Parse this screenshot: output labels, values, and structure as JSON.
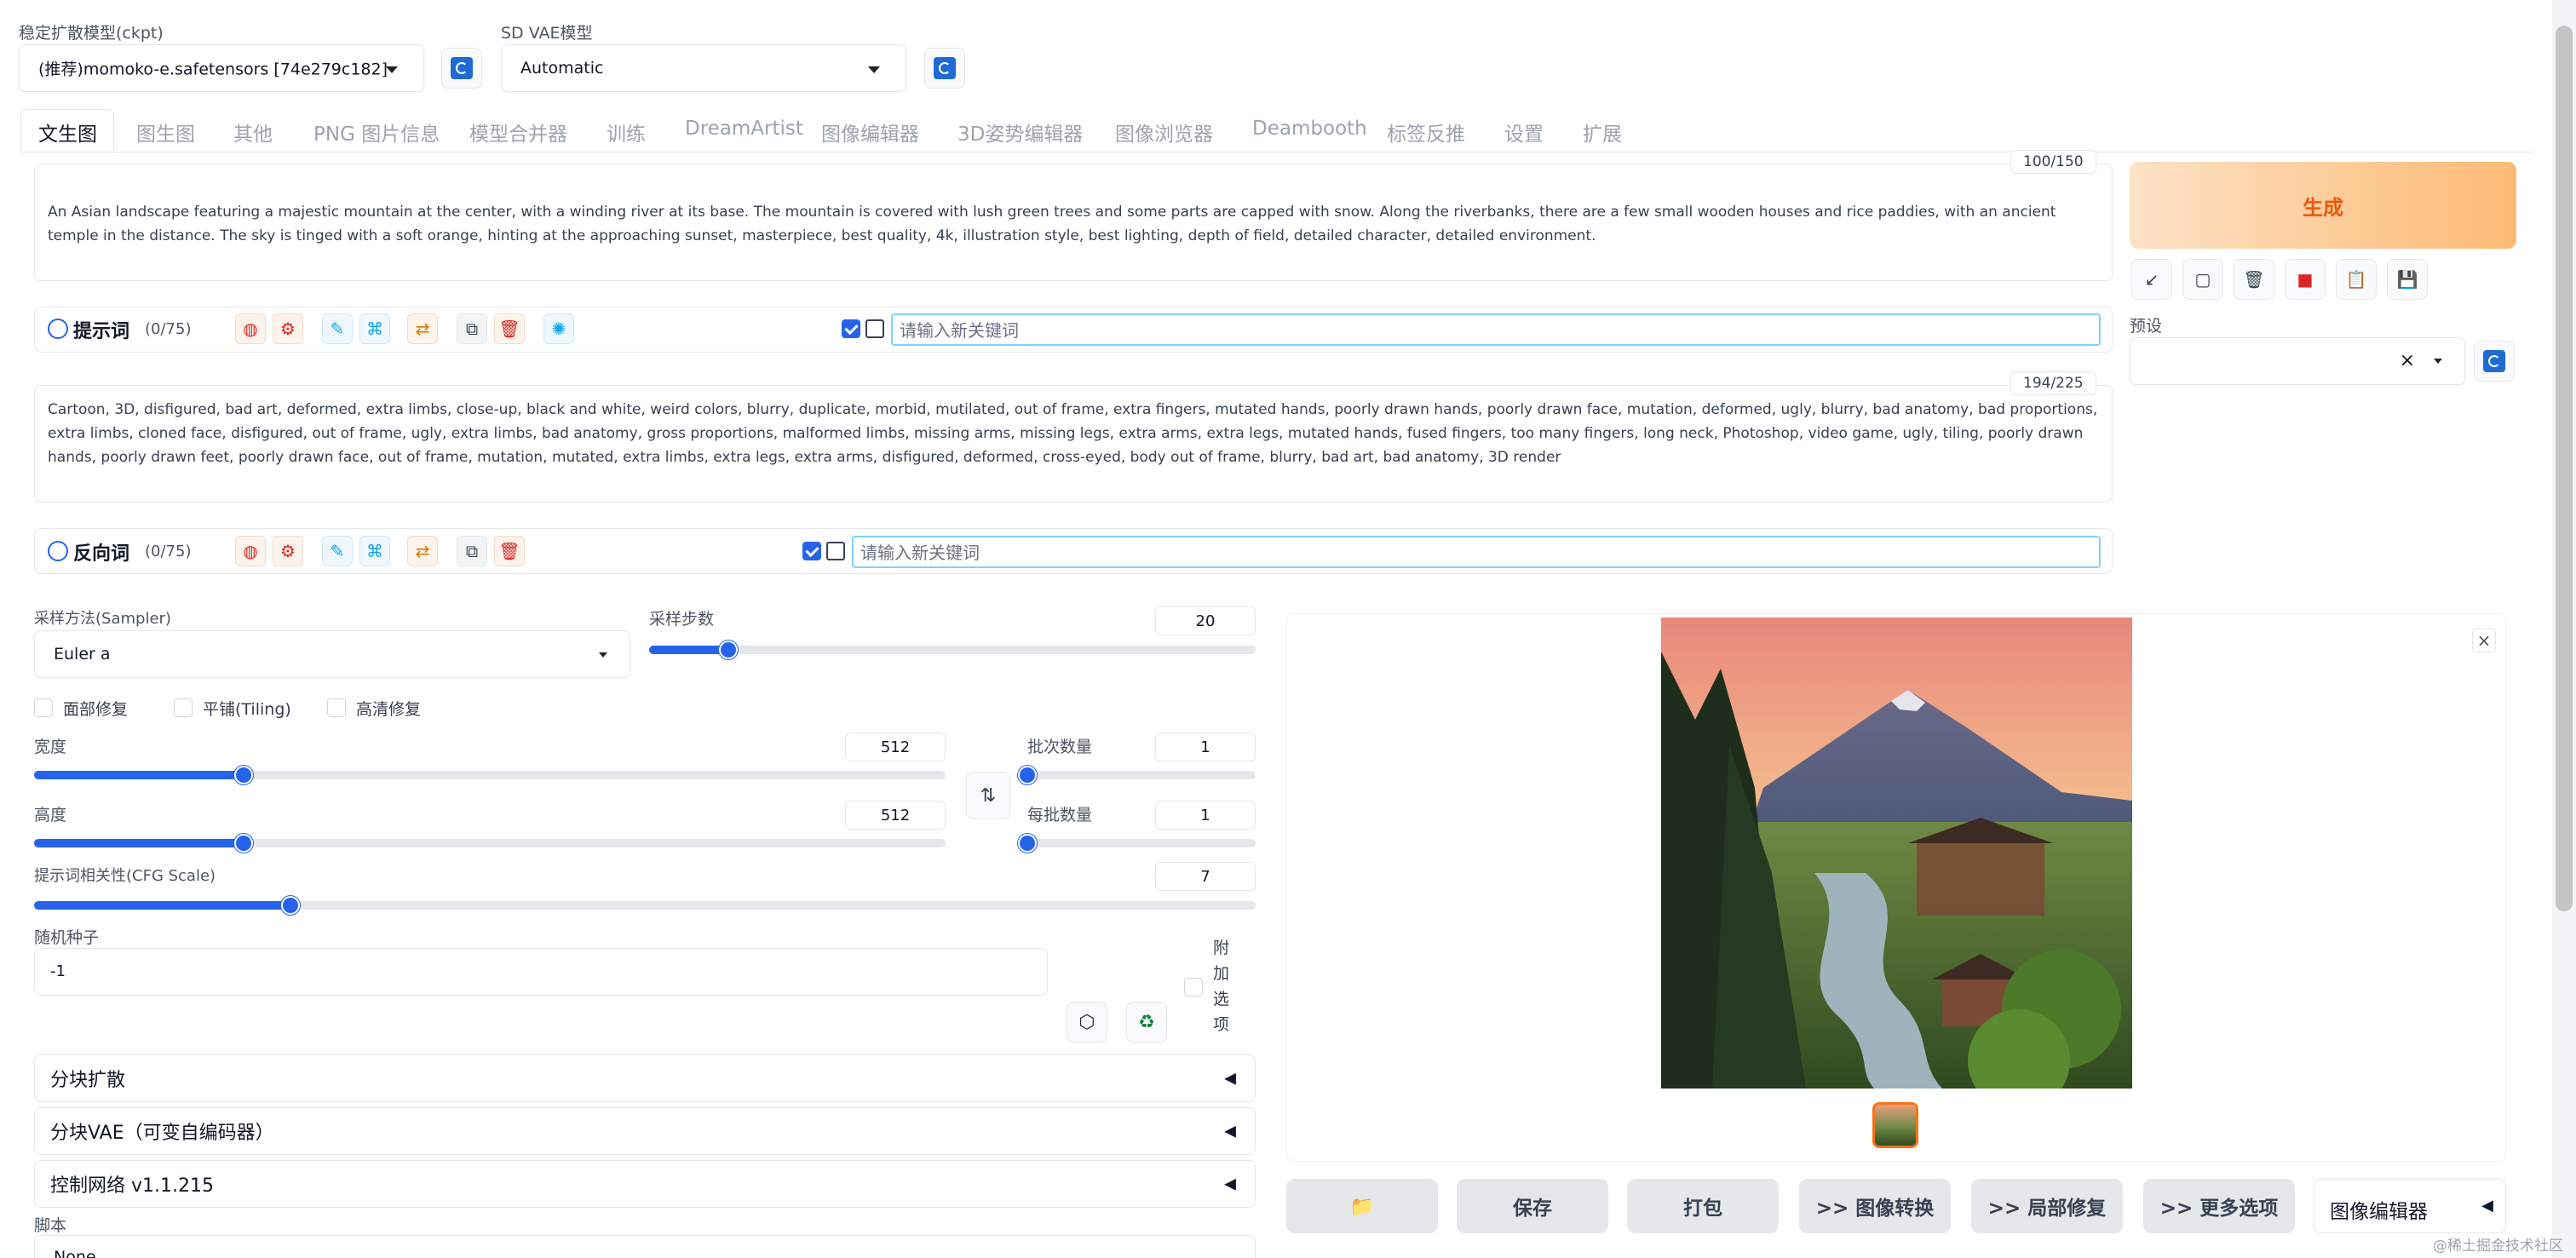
{
  "ckpt": {
    "label": "稳定扩散模型(ckpt)",
    "value": "(推荐)momoko-e.safetensors [74e279c182]"
  },
  "vae": {
    "label": "SD VAE模型",
    "value": "Automatic"
  },
  "tabs": [
    "文生图",
    "图生图",
    "其他",
    "PNG 图片信息",
    "模型合并器",
    "训练",
    "DreamArtist",
    "图像编辑器",
    "3D姿势编辑器",
    "图像浏览器",
    "Deambooth",
    "标签反推",
    "设置",
    "扩展"
  ],
  "prompt": {
    "counter": "100/150",
    "text": "An Asian landscape featuring a majestic mountain at the center, with a winding river at its base. The mountain is covered with lush green trees and some parts are capped with snow. Along the riverbanks, there are a few small wooden houses and rice paddies, with an ancient temple in the distance. The sky is tinged with a soft orange, hinting at the approaching sunset, masterpiece, best quality, 4k, illustration style, best lighting, depth of field, detailed character, detailed environment.",
    "panel_title": "提示词",
    "panel_count": "(0/75)",
    "keyword_placeholder": "请输入新关键词"
  },
  "negative": {
    "counter": "194/225",
    "text": "Cartoon, 3D, disfigured, bad art, deformed, extra limbs, close-up, black and white, weird colors, blurry, duplicate, morbid, mutilated, out of frame, extra fingers, mutated hands, poorly drawn hands, poorly drawn face, mutation, deformed, ugly, blurry, bad anatomy, bad proportions, extra limbs, cloned face, disfigured, out of frame, ugly, extra limbs, bad anatomy, gross proportions, malformed limbs, missing arms, missing legs, extra arms, extra legs, mutated hands, fused fingers, too many fingers, long neck, Photoshop, video game, ugly, tiling, poorly drawn hands, poorly drawn feet, poorly drawn face, out of frame, mutation, mutated, extra limbs, extra legs, extra arms, disfigured, deformed, cross-eyed, body out of frame, blurry, bad art, bad anatomy, 3D render",
    "panel_title": "反向词",
    "panel_count": "(0/75)",
    "keyword_placeholder": "请输入新关键词"
  },
  "generate": "生成",
  "preset_label": "预设",
  "sampler": {
    "label": "采样方法(Sampler)",
    "value": "Euler a"
  },
  "steps": {
    "label": "采样步数",
    "value": "20",
    "fraction": 0.13
  },
  "checks": {
    "face": "面部修复",
    "tiling": "平铺(Tiling)",
    "hires": "高清修复"
  },
  "width": {
    "label": "宽度",
    "value": "512",
    "fraction": 0.23
  },
  "height": {
    "label": "高度",
    "value": "512",
    "fraction": 0.23
  },
  "batch_count": {
    "label": "批次数量",
    "value": "1",
    "fraction": 0.0
  },
  "batch_size": {
    "label": "每批数量",
    "value": "1",
    "fraction": 0.0
  },
  "cfg": {
    "label": "提示词相关性(CFG Scale)",
    "value": "7",
    "fraction": 0.21
  },
  "seed": {
    "label": "随机种子",
    "value": "-1",
    "extra": "附加选项"
  },
  "accordions": [
    "分块扩散",
    "分块VAE（可变自编码器）",
    "控制网络 v1.1.215"
  ],
  "script": {
    "label": "脚本",
    "value": "None"
  },
  "buttons": {
    "save": "保存",
    "zip": "打包",
    "to_img2img": ">> 图像转换",
    "to_inpaint": ">> 局部修复",
    "more": ">> 更多选项",
    "editor": "图像编辑器"
  },
  "watermark": "@稀土掘金技术社区",
  "colors": {
    "accent": "#2563eb",
    "generate_text": "#ea580c"
  }
}
